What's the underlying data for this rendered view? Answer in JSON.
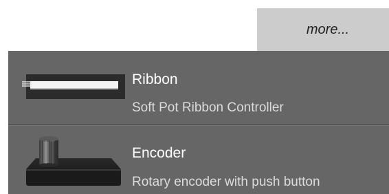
{
  "header": {
    "more_label": "more..."
  },
  "items": [
    {
      "title": "Ribbon",
      "subtitle": "Soft Pot Ribbon Controller",
      "icon": "ribbon-controller-icon"
    },
    {
      "title": "Encoder",
      "subtitle": "Rotary encoder with push button",
      "icon": "rotary-encoder-icon"
    }
  ],
  "colors": {
    "list_background": "#666666",
    "more_button_background": "#cccccc",
    "title_text": "#ffffff",
    "subtitle_text": "#dcdcdc"
  }
}
